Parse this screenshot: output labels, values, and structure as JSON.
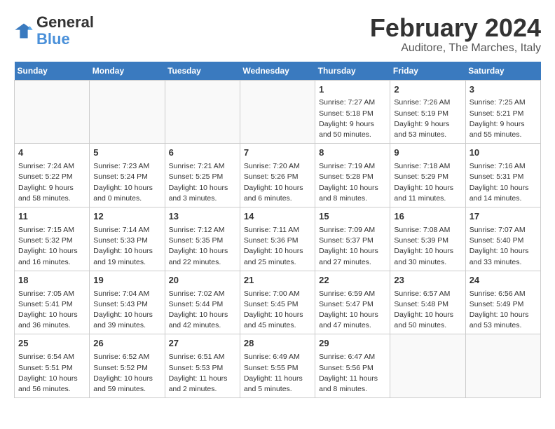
{
  "header": {
    "logo_general": "General",
    "logo_blue": "Blue",
    "title": "February 2024",
    "subtitle": "Auditore, The Marches, Italy"
  },
  "calendar": {
    "days_of_week": [
      "Sunday",
      "Monday",
      "Tuesday",
      "Wednesday",
      "Thursday",
      "Friday",
      "Saturday"
    ],
    "weeks": [
      [
        {
          "day": "",
          "info": ""
        },
        {
          "day": "",
          "info": ""
        },
        {
          "day": "",
          "info": ""
        },
        {
          "day": "",
          "info": ""
        },
        {
          "day": "1",
          "info": "Sunrise: 7:27 AM\nSunset: 5:18 PM\nDaylight: 9 hours and 50 minutes."
        },
        {
          "day": "2",
          "info": "Sunrise: 7:26 AM\nSunset: 5:19 PM\nDaylight: 9 hours and 53 minutes."
        },
        {
          "day": "3",
          "info": "Sunrise: 7:25 AM\nSunset: 5:21 PM\nDaylight: 9 hours and 55 minutes."
        }
      ],
      [
        {
          "day": "4",
          "info": "Sunrise: 7:24 AM\nSunset: 5:22 PM\nDaylight: 9 hours and 58 minutes."
        },
        {
          "day": "5",
          "info": "Sunrise: 7:23 AM\nSunset: 5:24 PM\nDaylight: 10 hours and 0 minutes."
        },
        {
          "day": "6",
          "info": "Sunrise: 7:21 AM\nSunset: 5:25 PM\nDaylight: 10 hours and 3 minutes."
        },
        {
          "day": "7",
          "info": "Sunrise: 7:20 AM\nSunset: 5:26 PM\nDaylight: 10 hours and 6 minutes."
        },
        {
          "day": "8",
          "info": "Sunrise: 7:19 AM\nSunset: 5:28 PM\nDaylight: 10 hours and 8 minutes."
        },
        {
          "day": "9",
          "info": "Sunrise: 7:18 AM\nSunset: 5:29 PM\nDaylight: 10 hours and 11 minutes."
        },
        {
          "day": "10",
          "info": "Sunrise: 7:16 AM\nSunset: 5:31 PM\nDaylight: 10 hours and 14 minutes."
        }
      ],
      [
        {
          "day": "11",
          "info": "Sunrise: 7:15 AM\nSunset: 5:32 PM\nDaylight: 10 hours and 16 minutes."
        },
        {
          "day": "12",
          "info": "Sunrise: 7:14 AM\nSunset: 5:33 PM\nDaylight: 10 hours and 19 minutes."
        },
        {
          "day": "13",
          "info": "Sunrise: 7:12 AM\nSunset: 5:35 PM\nDaylight: 10 hours and 22 minutes."
        },
        {
          "day": "14",
          "info": "Sunrise: 7:11 AM\nSunset: 5:36 PM\nDaylight: 10 hours and 25 minutes."
        },
        {
          "day": "15",
          "info": "Sunrise: 7:09 AM\nSunset: 5:37 PM\nDaylight: 10 hours and 27 minutes."
        },
        {
          "day": "16",
          "info": "Sunrise: 7:08 AM\nSunset: 5:39 PM\nDaylight: 10 hours and 30 minutes."
        },
        {
          "day": "17",
          "info": "Sunrise: 7:07 AM\nSunset: 5:40 PM\nDaylight: 10 hours and 33 minutes."
        }
      ],
      [
        {
          "day": "18",
          "info": "Sunrise: 7:05 AM\nSunset: 5:41 PM\nDaylight: 10 hours and 36 minutes."
        },
        {
          "day": "19",
          "info": "Sunrise: 7:04 AM\nSunset: 5:43 PM\nDaylight: 10 hours and 39 minutes."
        },
        {
          "day": "20",
          "info": "Sunrise: 7:02 AM\nSunset: 5:44 PM\nDaylight: 10 hours and 42 minutes."
        },
        {
          "day": "21",
          "info": "Sunrise: 7:00 AM\nSunset: 5:45 PM\nDaylight: 10 hours and 45 minutes."
        },
        {
          "day": "22",
          "info": "Sunrise: 6:59 AM\nSunset: 5:47 PM\nDaylight: 10 hours and 47 minutes."
        },
        {
          "day": "23",
          "info": "Sunrise: 6:57 AM\nSunset: 5:48 PM\nDaylight: 10 hours and 50 minutes."
        },
        {
          "day": "24",
          "info": "Sunrise: 6:56 AM\nSunset: 5:49 PM\nDaylight: 10 hours and 53 minutes."
        }
      ],
      [
        {
          "day": "25",
          "info": "Sunrise: 6:54 AM\nSunset: 5:51 PM\nDaylight: 10 hours and 56 minutes."
        },
        {
          "day": "26",
          "info": "Sunrise: 6:52 AM\nSunset: 5:52 PM\nDaylight: 10 hours and 59 minutes."
        },
        {
          "day": "27",
          "info": "Sunrise: 6:51 AM\nSunset: 5:53 PM\nDaylight: 11 hours and 2 minutes."
        },
        {
          "day": "28",
          "info": "Sunrise: 6:49 AM\nSunset: 5:55 PM\nDaylight: 11 hours and 5 minutes."
        },
        {
          "day": "29",
          "info": "Sunrise: 6:47 AM\nSunset: 5:56 PM\nDaylight: 11 hours and 8 minutes."
        },
        {
          "day": "",
          "info": ""
        },
        {
          "day": "",
          "info": ""
        }
      ]
    ]
  }
}
